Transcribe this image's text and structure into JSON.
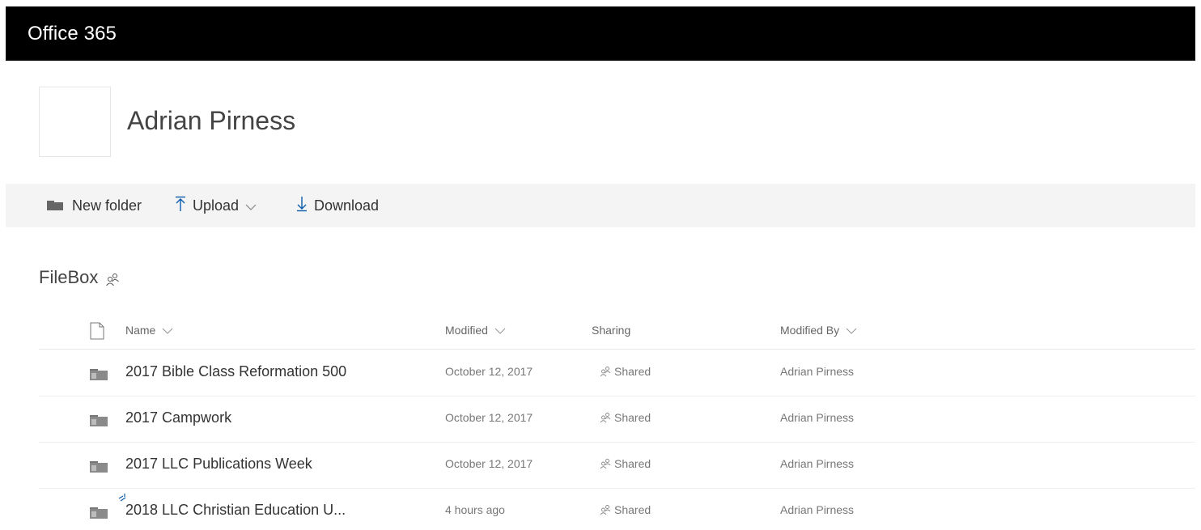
{
  "app": {
    "title": "Office 365"
  },
  "site": {
    "title": "Adrian Pirness"
  },
  "commands": {
    "new_folder": "New folder",
    "upload": "Upload",
    "download": "Download"
  },
  "library": {
    "title": "FileBox"
  },
  "columns": {
    "name": "Name",
    "modified": "Modified",
    "sharing": "Sharing",
    "modified_by": "Modified By"
  },
  "rows": [
    {
      "name": "2017 Bible Class Reformation 500",
      "modified": "October 12, 2017",
      "sharing": "Shared",
      "modified_by": "Adrian Pirness",
      "is_new": false
    },
    {
      "name": "2017 Campwork",
      "modified": "October 12, 2017",
      "sharing": "Shared",
      "modified_by": "Adrian Pirness",
      "is_new": false
    },
    {
      "name": "2017 LLC Publications Week",
      "modified": "October 12, 2017",
      "sharing": "Shared",
      "modified_by": "Adrian Pirness",
      "is_new": false
    },
    {
      "name": "2018 LLC Christian Education U...",
      "modified": "4 hours ago",
      "sharing": "Shared",
      "modified_by": "Adrian Pirness",
      "is_new": true
    }
  ],
  "icons": {
    "folder": "folder-icon",
    "upload": "upload-arrow-icon",
    "download": "download-arrow-icon",
    "shared": "people-icon",
    "file_type": "document-icon"
  },
  "colors": {
    "topbar": "#000000",
    "accent": "#0b5cad",
    "commandbar": "#f4f4f4"
  }
}
